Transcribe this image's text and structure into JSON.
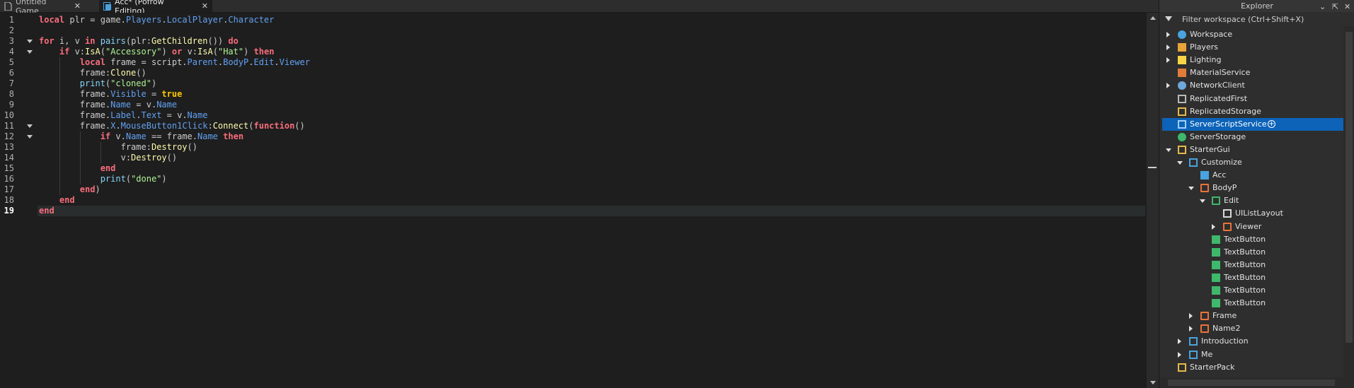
{
  "tabs": [
    {
      "label": "Untitled Game",
      "active": false,
      "icon": "document-icon"
    },
    {
      "label": "Acc* (Pofrow Editing)",
      "active": true,
      "icon": "script-icon"
    }
  ],
  "tab_close_glyph": "✕",
  "editor": {
    "current_line": 19,
    "line_numbers": [
      "1",
      "2",
      "3",
      "4",
      "5",
      "6",
      "7",
      "8",
      "9",
      "10",
      "11",
      "12",
      "13",
      "14",
      "15",
      "16",
      "17",
      "18",
      "19"
    ],
    "folds_at": [
      3,
      4,
      11,
      12
    ],
    "lines": [
      [
        {
          "t": "local",
          "c": "kw"
        },
        {
          "t": " plr = game."
        },
        {
          "t": "Players",
          "c": "prop"
        },
        {
          "t": "."
        },
        {
          "t": "LocalPlayer",
          "c": "prop"
        },
        {
          "t": "."
        },
        {
          "t": "Character",
          "c": "prop"
        }
      ],
      [],
      [
        {
          "t": "for",
          "c": "kw"
        },
        {
          "t": " i, v "
        },
        {
          "t": "in",
          "c": "kw"
        },
        {
          "t": " "
        },
        {
          "t": "pairs",
          "c": "bi"
        },
        {
          "t": "(plr:"
        },
        {
          "t": "GetChildren",
          "c": "fn"
        },
        {
          "t": "()) "
        },
        {
          "t": "do",
          "c": "kw"
        }
      ],
      [
        {
          "t": "    "
        },
        {
          "t": "if",
          "c": "kw"
        },
        {
          "t": " v:"
        },
        {
          "t": "IsA",
          "c": "fn"
        },
        {
          "t": "("
        },
        {
          "t": "\"Accessory\"",
          "c": "str"
        },
        {
          "t": ") "
        },
        {
          "t": "or",
          "c": "kw"
        },
        {
          "t": " v:"
        },
        {
          "t": "IsA",
          "c": "fn"
        },
        {
          "t": "("
        },
        {
          "t": "\"Hat\"",
          "c": "str"
        },
        {
          "t": ") "
        },
        {
          "t": "then",
          "c": "kw"
        }
      ],
      [
        {
          "t": "        "
        },
        {
          "t": "local",
          "c": "kw"
        },
        {
          "t": " frame = script."
        },
        {
          "t": "Parent",
          "c": "prop"
        },
        {
          "t": "."
        },
        {
          "t": "BodyP",
          "c": "prop"
        },
        {
          "t": "."
        },
        {
          "t": "Edit",
          "c": "prop"
        },
        {
          "t": "."
        },
        {
          "t": "Viewer",
          "c": "prop"
        }
      ],
      [
        {
          "t": "        frame:"
        },
        {
          "t": "Clone",
          "c": "fn"
        },
        {
          "t": "()"
        }
      ],
      [
        {
          "t": "        "
        },
        {
          "t": "print",
          "c": "bi"
        },
        {
          "t": "("
        },
        {
          "t": "\"cloned\"",
          "c": "str"
        },
        {
          "t": ")"
        }
      ],
      [
        {
          "t": "        frame."
        },
        {
          "t": "Visible",
          "c": "prop"
        },
        {
          "t": " = "
        },
        {
          "t": "true",
          "c": "boo"
        }
      ],
      [
        {
          "t": "        frame."
        },
        {
          "t": "Name",
          "c": "prop"
        },
        {
          "t": " = v."
        },
        {
          "t": "Name",
          "c": "prop"
        }
      ],
      [
        {
          "t": "        frame."
        },
        {
          "t": "Label",
          "c": "prop"
        },
        {
          "t": "."
        },
        {
          "t": "Text",
          "c": "prop"
        },
        {
          "t": " = v."
        },
        {
          "t": "Name",
          "c": "prop"
        }
      ],
      [
        {
          "t": "        frame."
        },
        {
          "t": "X",
          "c": "prop"
        },
        {
          "t": "."
        },
        {
          "t": "MouseButton1Click",
          "c": "prop"
        },
        {
          "t": ":"
        },
        {
          "t": "Connect",
          "c": "fn"
        },
        {
          "t": "("
        },
        {
          "t": "function",
          "c": "kw"
        },
        {
          "t": "()"
        }
      ],
      [
        {
          "t": "            "
        },
        {
          "t": "if",
          "c": "kw"
        },
        {
          "t": " v."
        },
        {
          "t": "Name",
          "c": "prop"
        },
        {
          "t": " == frame."
        },
        {
          "t": "Name",
          "c": "prop"
        },
        {
          "t": " "
        },
        {
          "t": "then",
          "c": "kw"
        }
      ],
      [
        {
          "t": "                frame:"
        },
        {
          "t": "Destroy",
          "c": "fn"
        },
        {
          "t": "()"
        }
      ],
      [
        {
          "t": "                v:"
        },
        {
          "t": "Destroy",
          "c": "fn"
        },
        {
          "t": "()"
        }
      ],
      [
        {
          "t": "            "
        },
        {
          "t": "end",
          "c": "kw"
        }
      ],
      [
        {
          "t": "            "
        },
        {
          "t": "print",
          "c": "bi"
        },
        {
          "t": "("
        },
        {
          "t": "\"done\"",
          "c": "str"
        },
        {
          "t": ")"
        }
      ],
      [
        {
          "t": "        "
        },
        {
          "t": "end",
          "c": "kw"
        },
        {
          "t": ")"
        }
      ],
      [
        {
          "t": "    "
        },
        {
          "t": "end",
          "c": "kw"
        }
      ],
      [
        {
          "t": "end",
          "c": "kw"
        }
      ]
    ]
  },
  "explorer": {
    "title": "Explorer",
    "filter_placeholder": "Filter workspace (Ctrl+Shift+X)",
    "header_buttons": [
      "⌄",
      "⇱",
      "✕"
    ],
    "items": [
      {
        "label": "Workspace",
        "depth": 0,
        "expander": "collapsed",
        "icon": "workspace-icon",
        "color": "#4aa3df"
      },
      {
        "label": "Players",
        "depth": 0,
        "expander": "collapsed",
        "icon": "players-icon",
        "color": "#e8a33a"
      },
      {
        "label": "Lighting",
        "depth": 0,
        "expander": "collapsed",
        "icon": "lighting-icon",
        "color": "#f5d547"
      },
      {
        "label": "MaterialService",
        "depth": 0,
        "expander": "none",
        "icon": "material-service-icon",
        "color": "#e07b39"
      },
      {
        "label": "NetworkClient",
        "depth": 0,
        "expander": "collapsed",
        "icon": "network-client-icon",
        "color": "#6fa8dc"
      },
      {
        "label": "ReplicatedFirst",
        "depth": 0,
        "expander": "none",
        "icon": "replicated-first-icon",
        "color": "#b9b9b9"
      },
      {
        "label": "ReplicatedStorage",
        "depth": 0,
        "expander": "none",
        "icon": "replicated-storage-icon",
        "color": "#e6b84c"
      },
      {
        "label": "ServerScriptService",
        "depth": 0,
        "expander": "none",
        "icon": "server-script-service-icon",
        "color": "#9fd0ff",
        "selected": true
      },
      {
        "label": "ServerStorage",
        "depth": 0,
        "expander": "none",
        "icon": "server-storage-icon",
        "color": "#3fb86b"
      },
      {
        "label": "StarterGui",
        "depth": 0,
        "expander": "expanded",
        "icon": "starter-gui-icon",
        "color": "#e6b84c"
      },
      {
        "label": "Customize",
        "depth": 1,
        "expander": "expanded",
        "icon": "screen-gui-icon",
        "color": "#4aa3df"
      },
      {
        "label": "Acc",
        "depth": 2,
        "expander": "none",
        "icon": "local-script-icon",
        "color": "#4aa3df"
      },
      {
        "label": "BodyP",
        "depth": 2,
        "expander": "expanded",
        "icon": "frame-icon",
        "color": "#e8743b"
      },
      {
        "label": "Edit",
        "depth": 3,
        "expander": "expanded",
        "icon": "scrolling-frame-icon",
        "color": "#3fb86b"
      },
      {
        "label": "UIListLayout",
        "depth": 4,
        "expander": "none",
        "icon": "list-layout-icon",
        "color": "#d8d8d8"
      },
      {
        "label": "Viewer",
        "depth": 4,
        "expander": "collapsed",
        "icon": "frame-icon",
        "color": "#e8743b"
      },
      {
        "label": "TextButton",
        "depth": 3,
        "expander": "none",
        "icon": "text-button-icon",
        "color": "#3fb86b"
      },
      {
        "label": "TextButton",
        "depth": 3,
        "expander": "none",
        "icon": "text-button-icon",
        "color": "#3fb86b"
      },
      {
        "label": "TextButton",
        "depth": 3,
        "expander": "none",
        "icon": "text-button-icon",
        "color": "#3fb86b"
      },
      {
        "label": "TextButton",
        "depth": 3,
        "expander": "none",
        "icon": "text-button-icon",
        "color": "#3fb86b"
      },
      {
        "label": "TextButton",
        "depth": 3,
        "expander": "none",
        "icon": "text-button-icon",
        "color": "#3fb86b"
      },
      {
        "label": "TextButton",
        "depth": 3,
        "expander": "none",
        "icon": "text-button-icon",
        "color": "#3fb86b"
      },
      {
        "label": "Frame",
        "depth": 2,
        "expander": "collapsed",
        "icon": "frame-icon",
        "color": "#e8743b"
      },
      {
        "label": "Name2",
        "depth": 2,
        "expander": "collapsed",
        "icon": "frame-icon",
        "color": "#e8743b"
      },
      {
        "label": "Introduction",
        "depth": 1,
        "expander": "collapsed",
        "icon": "screen-gui-icon",
        "color": "#4aa3df"
      },
      {
        "label": "Me",
        "depth": 1,
        "expander": "collapsed",
        "icon": "screen-gui-icon",
        "color": "#4aa3df"
      },
      {
        "label": "StarterPack",
        "depth": 0,
        "expander": "none",
        "icon": "starter-pack-icon",
        "color": "#e6b84c"
      }
    ]
  }
}
